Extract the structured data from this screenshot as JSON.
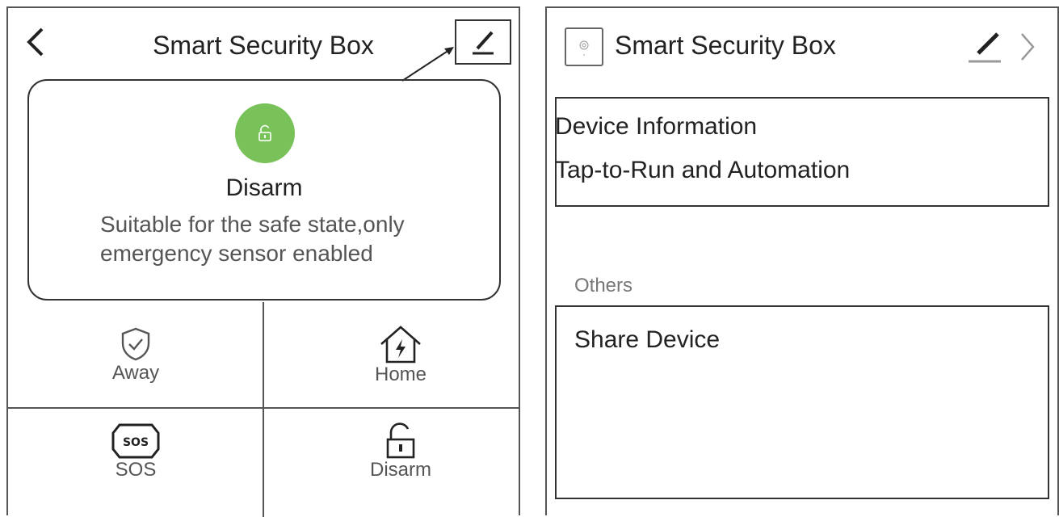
{
  "left": {
    "title": "Smart Security Box",
    "mode": {
      "name": "Disarm",
      "description": "Suitable for the safe state,only emergency sensor enabled",
      "color": "#79c25a"
    },
    "modes": [
      {
        "label": "Away",
        "icon": "shield-check-icon"
      },
      {
        "label": "Home",
        "icon": "house-bolt-icon"
      },
      {
        "label": "SOS",
        "icon": "sos-icon"
      },
      {
        "label": "Disarm",
        "icon": "unlock-icon"
      }
    ]
  },
  "right": {
    "title": "Smart Security Box",
    "items": [
      "Device Information",
      "Tap-to-Run and Automation"
    ],
    "section_label": "Others",
    "share_label": "Share Device"
  }
}
